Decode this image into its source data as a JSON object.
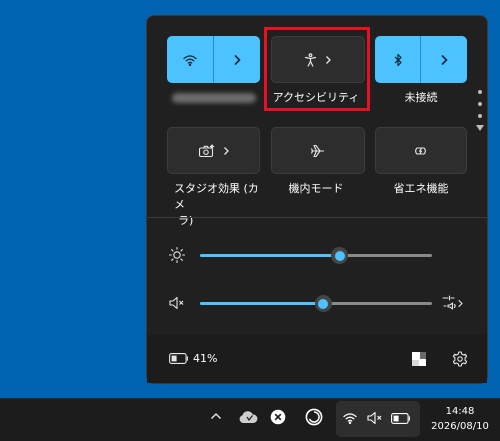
{
  "quick_settings": {
    "tiles_row1": [
      {
        "id": "wifi",
        "icon": "wifi-icon",
        "state": "on",
        "label_blurred": true
      },
      {
        "id": "accessibility",
        "icon": "accessibility-icon",
        "state": "off",
        "label": "アクセシビリティ"
      },
      {
        "id": "bluetooth",
        "icon": "bluetooth-icon",
        "state": "on",
        "label": "未接続"
      }
    ],
    "tiles_row2": [
      {
        "id": "studio-effects",
        "icon": "studio-effects-icon",
        "state": "off",
        "label": "スタジオ効果 (カメラ)",
        "label_line1": "スタジオ効果 (カメ",
        "label_line2": "ラ)"
      },
      {
        "id": "airplane-mode",
        "icon": "airplane-icon",
        "state": "off",
        "label": "機内モード"
      },
      {
        "id": "energy-saver",
        "icon": "energy-saver-icon",
        "state": "off",
        "label": "省エネ機能"
      }
    ],
    "brightness": {
      "icon": "brightness-icon",
      "level": 0.6
    },
    "volume": {
      "icon": "volume-muted-icon",
      "level": 0.53,
      "muted": true
    },
    "footer": {
      "battery_percent": "41%",
      "battery_icon": "battery-icon",
      "settings_icon": "gear-icon"
    }
  },
  "taskbar": {
    "tray_icons": [
      "chevron-up-icon",
      "onedrive-icon",
      "error-app-icon",
      "app-circle-icon"
    ],
    "clock_time": "14:48",
    "clock_date": "2026/08/10"
  },
  "colors": {
    "accent": "#4cc2ff",
    "desktop": "#0063b1",
    "panel": "#202020",
    "highlight": "#e81123"
  }
}
